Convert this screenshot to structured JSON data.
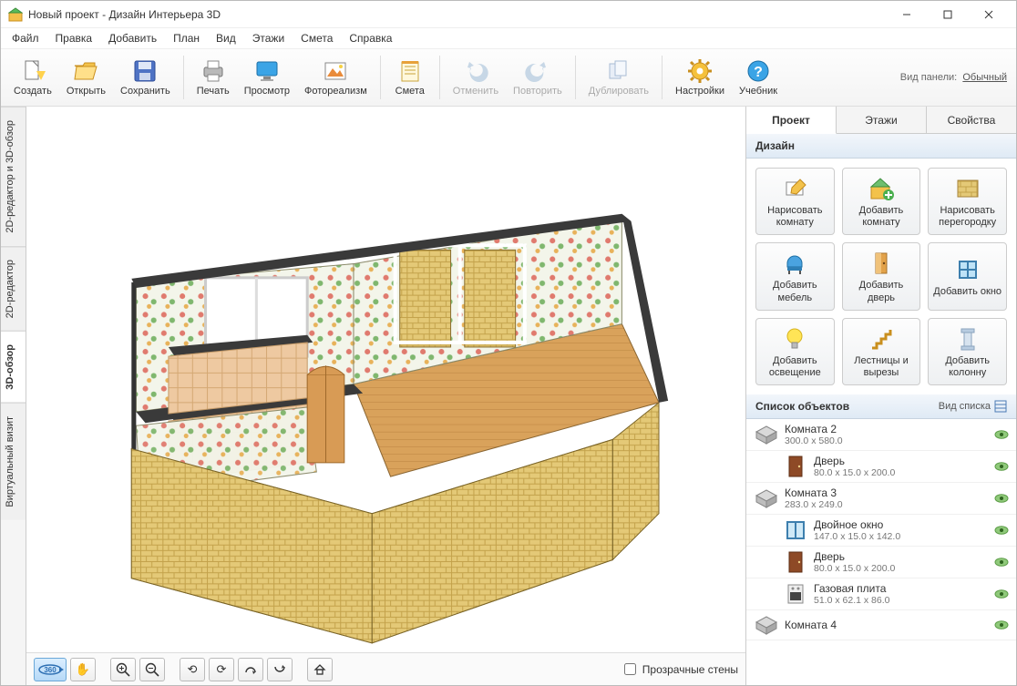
{
  "window": {
    "title": "Новый проект - Дизайн Интерьера 3D"
  },
  "menu": [
    "Файл",
    "Правка",
    "Добавить",
    "План",
    "Вид",
    "Этажи",
    "Смета",
    "Справка"
  ],
  "toolbar": {
    "create": "Создать",
    "open": "Открыть",
    "save": "Сохранить",
    "print": "Печать",
    "preview": "Просмотр",
    "photo": "Фотореализм",
    "estimate": "Смета",
    "undo": "Отменить",
    "redo": "Повторить",
    "duplicate": "Дублировать",
    "settings": "Настройки",
    "help": "Учебник",
    "panel_label": "Вид панели:",
    "panel_value": "Обычный"
  },
  "vtabs": {
    "t1": "2D-редактор и 3D-обзор",
    "t2": "2D-редактор",
    "t3": "3D-обзор",
    "t4": "Виртуальный визит"
  },
  "viewbar": {
    "rotate360": "360",
    "transparent_walls": "Прозрачные стены"
  },
  "right": {
    "tab_project": "Проект",
    "tab_floors": "Этажи",
    "tab_props": "Свойства",
    "design_header": "Дизайн",
    "buttons": [
      "Нарисовать комнату",
      "Добавить комнату",
      "Нарисовать перегородку",
      "Добавить мебель",
      "Добавить дверь",
      "Добавить окно",
      "Добавить освещение",
      "Лестницы и вырезы",
      "Добавить колонну"
    ],
    "list_header": "Список объектов",
    "list_mode": "Вид списка",
    "objects": [
      {
        "name": "Комната 2",
        "dim": "300.0 x 580.0",
        "indent": 0,
        "icon": "room"
      },
      {
        "name": "Дверь",
        "dim": "80.0 x 15.0 x 200.0",
        "indent": 1,
        "icon": "door"
      },
      {
        "name": "Комната 3",
        "dim": "283.0 x 249.0",
        "indent": 0,
        "icon": "room"
      },
      {
        "name": "Двойное окно",
        "dim": "147.0 x 15.0 x 142.0",
        "indent": 1,
        "icon": "window"
      },
      {
        "name": "Дверь",
        "dim": "80.0 x 15.0 x 200.0",
        "indent": 1,
        "icon": "door"
      },
      {
        "name": "Газовая плита",
        "dim": "51.0 x 62.1 x 86.0",
        "indent": 1,
        "icon": "stove"
      },
      {
        "name": "Комната 4",
        "dim": "",
        "indent": 0,
        "icon": "room"
      }
    ]
  }
}
